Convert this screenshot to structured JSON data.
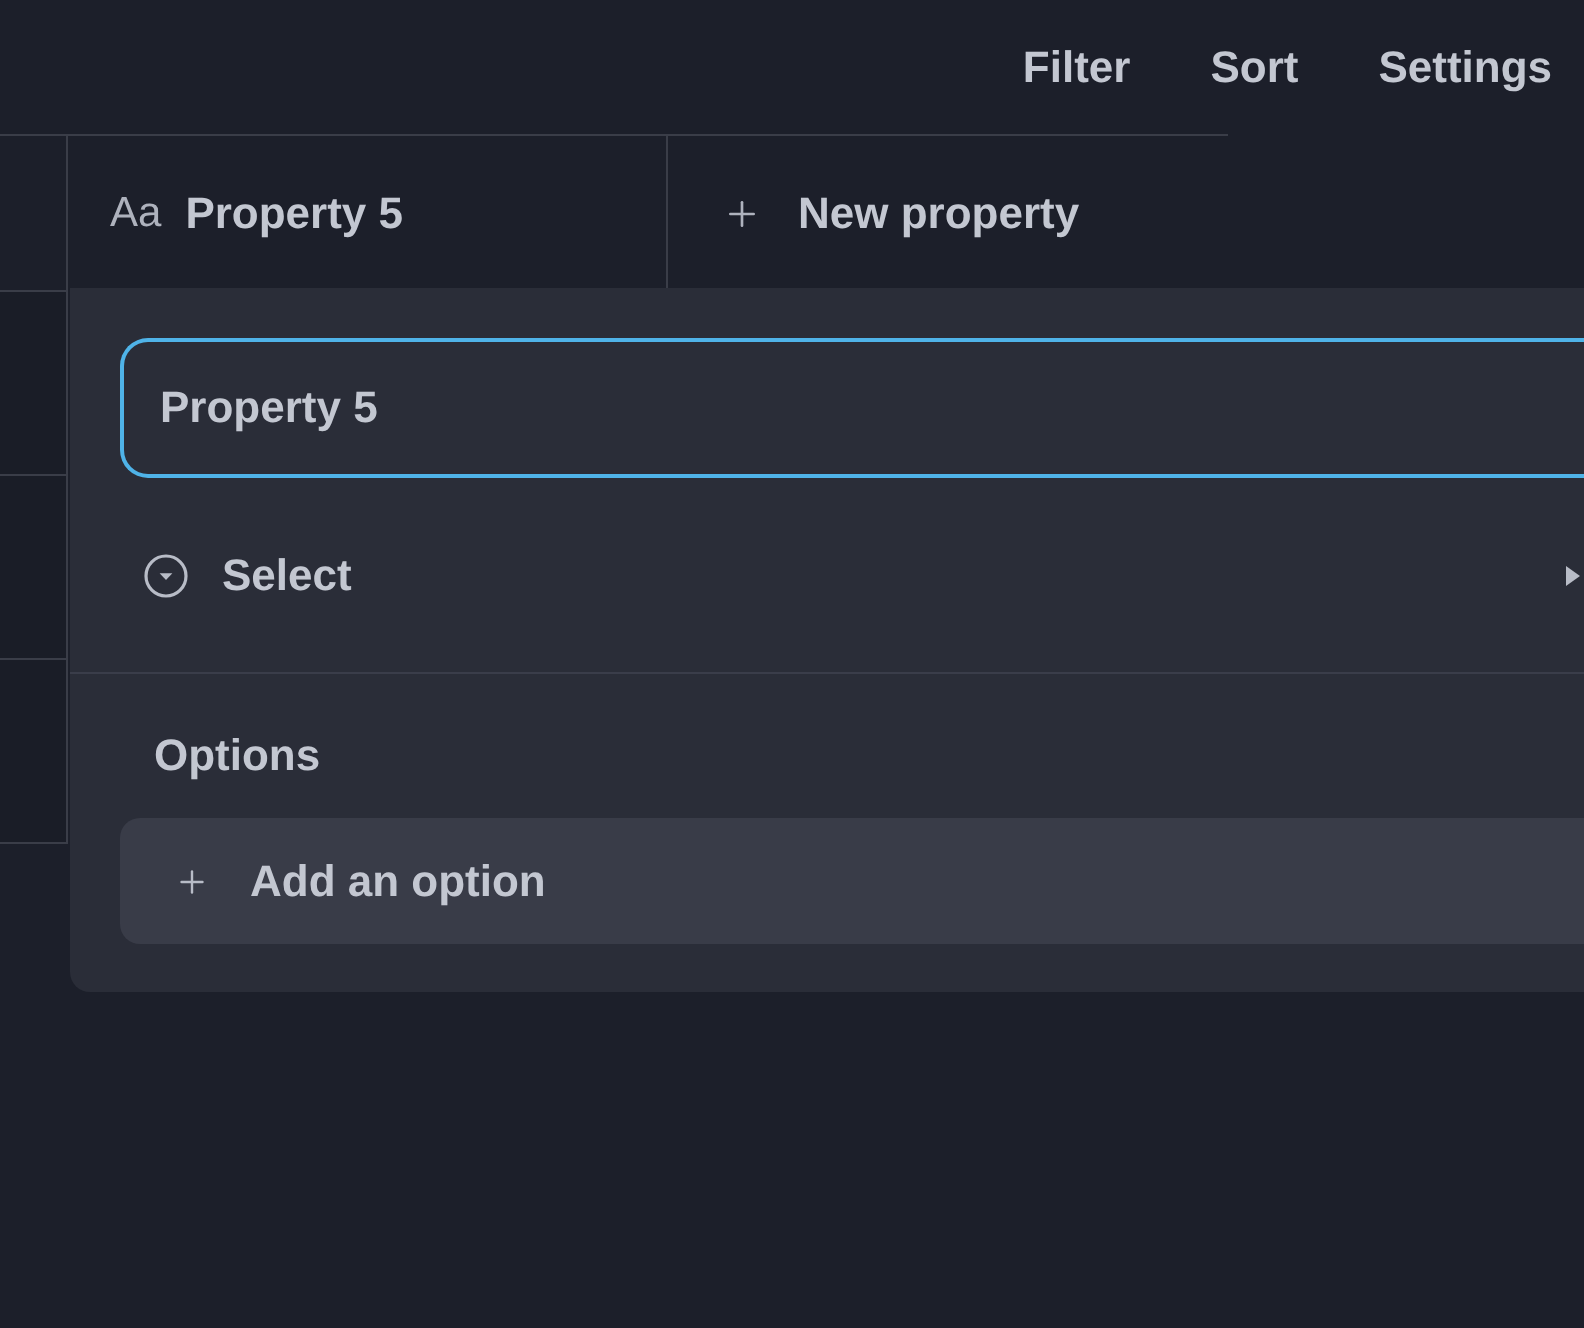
{
  "toolbar": {
    "buttons": [
      "Filter",
      "Sort",
      "Settings"
    ]
  },
  "table": {
    "columns": [
      {
        "kind": "text",
        "type_icon": "Aa",
        "label": "Property 5"
      },
      {
        "kind": "add",
        "label": "New property"
      }
    ]
  },
  "property_editor": {
    "name_field": {
      "value": "Property 5",
      "focused": true
    },
    "type_item": {
      "kind": "select",
      "label": "Select"
    },
    "options_heading": "Options",
    "add_option": {
      "label": "Add an option"
    }
  }
}
